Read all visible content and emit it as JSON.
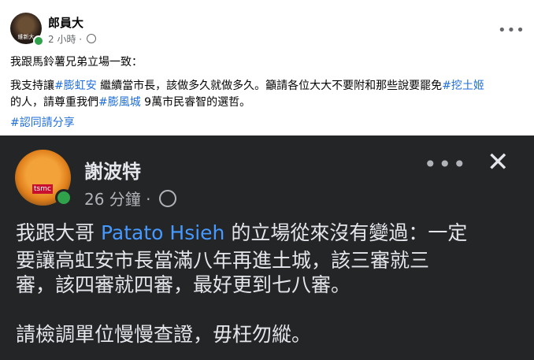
{
  "post": {
    "author": "郎員大",
    "avatar_caption": "維新大",
    "time": "2 小時",
    "separator": "·",
    "more": "•••",
    "line1": "我跟馬鈴薯兄弟立場一致：",
    "line2": {
      "p1": "我支持讓",
      "tag1": "#膨虹安",
      "p2": " 繼續當市長，該做多久就做多久。籲請各位大大不要附和那些說要罷免",
      "tag2": "#挖土姬"
    },
    "line3": {
      "p1": "的人，請尊重我們",
      "tag1": "#膨風城",
      "p2": " 9萬市民睿智的選哲。"
    },
    "line4": "#認同請分享"
  },
  "screenshot": {
    "author": "謝波特",
    "avatar_label": "tsmc",
    "time": "26 分鐘",
    "separator": "·",
    "more": "•••",
    "close": "✕",
    "line1": {
      "p1": "我跟大哥 ",
      "mention": "Patato Hsieh",
      "p2": " 的立場從來沒有變過：一定"
    },
    "line2": "要讓高虹安市長當滿八年再進土城，該三審就三",
    "line3": "審，該四審就四審，最好更到七八審。",
    "line4": "請檢調單位慢慢查證，毋枉勿縱。"
  },
  "colors": {
    "link": "#216fdb",
    "dark_link": "#4599ff",
    "dark_bg": "#242526",
    "online": "#31a24c"
  }
}
